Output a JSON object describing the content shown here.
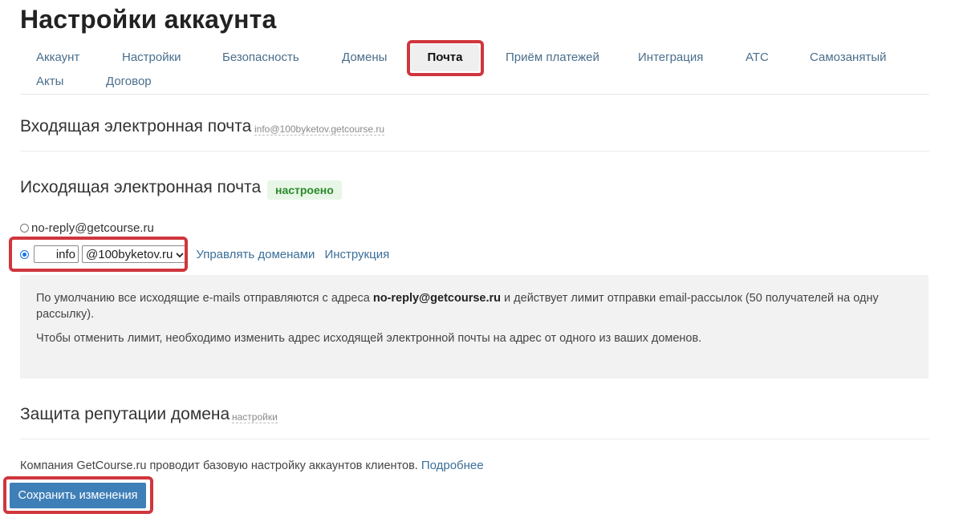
{
  "page": {
    "title": "Настройки аккаунта"
  },
  "tabs": [
    {
      "label": "Аккаунт"
    },
    {
      "label": "Настройки"
    },
    {
      "label": "Безопасность"
    },
    {
      "label": "Домены"
    },
    {
      "label": "Почта",
      "active": true
    },
    {
      "label": "Приём платежей"
    },
    {
      "label": "Интеграция"
    },
    {
      "label": "АТС"
    },
    {
      "label": "Самозанятый"
    },
    {
      "label": "Акты"
    },
    {
      "label": "Договор"
    }
  ],
  "incoming": {
    "title": "Входящая электронная почта",
    "address": "info@100byketov.getcourse.ru"
  },
  "outgoing": {
    "title": "Исходящая электронная почта",
    "status": "настроено",
    "option_default": "no-reply@getcourse.ru",
    "option_custom": {
      "local_part": "info",
      "domain": "@100byketov.ru",
      "manage_link": "Управлять доменами",
      "help_link": "Инструкция"
    },
    "info": {
      "line1_before": "По умолчанию все исходящие e-mails отправляются с адреса ",
      "line1_bold": "no-reply@getcourse.ru",
      "line1_after": " и действует лимит отправки email-рассылок (50 получателей на одну рассылку).",
      "line2": "Чтобы отменить лимит, необходимо изменить адрес исходящей электронной почты на адрес от одного из ваших доменов."
    }
  },
  "reputation": {
    "title": "Защита репутации домена",
    "settings_link": "настройки"
  },
  "footer": {
    "text": "Компания GetCourse.ru проводит базовую настройку аккаунтов клиентов.",
    "more_link": "Подробнее",
    "save_label": "Сохранить изменения"
  },
  "colors": {
    "highlight": "#d0363d",
    "link": "#3b6f99",
    "tab_link": "#4a6e8c",
    "badge_bg": "#e8f6e8",
    "badge_text": "#2a8a2a",
    "save_button": "#3f7fb8",
    "radio_checked": "#1a73e8"
  }
}
